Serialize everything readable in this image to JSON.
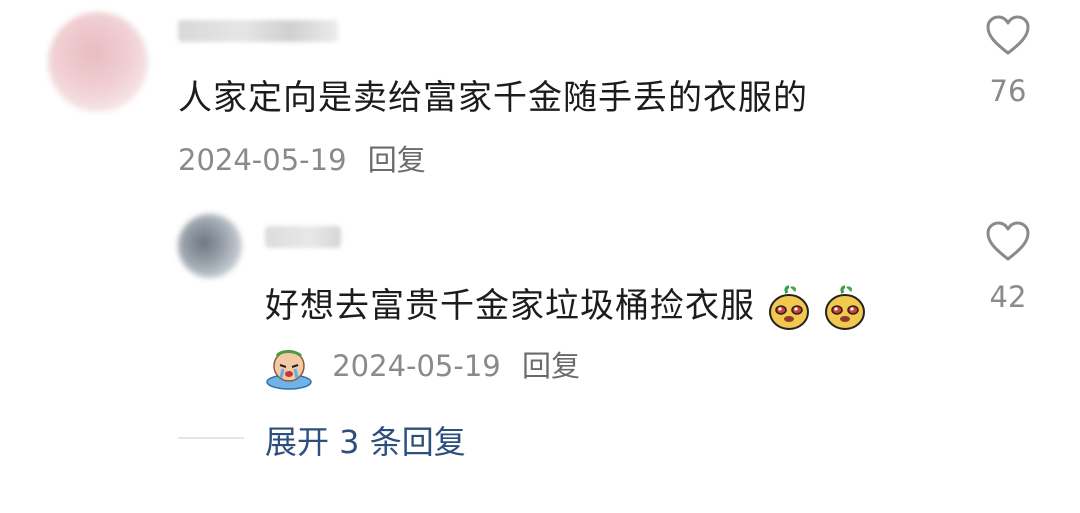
{
  "comments": [
    {
      "text": "人家定向是卖给富家千金随手丢的衣服的",
      "date": "2024-05-19",
      "reply_label": "回复",
      "likes": "76"
    },
    {
      "text": "好想去富贵千金家垃圾桶捡衣服",
      "date": "2024-05-19",
      "reply_label": "回复",
      "likes": "42",
      "emojis": [
        "puppy-emoji",
        "puppy-emoji"
      ],
      "date_prefix_emoji": "crying-face-emoji"
    }
  ],
  "expand": {
    "label": "展开 3 条回复"
  },
  "colors": {
    "link": "#2d4f7e",
    "meta": "#8a8a8a",
    "text": "#1c1c1c"
  }
}
